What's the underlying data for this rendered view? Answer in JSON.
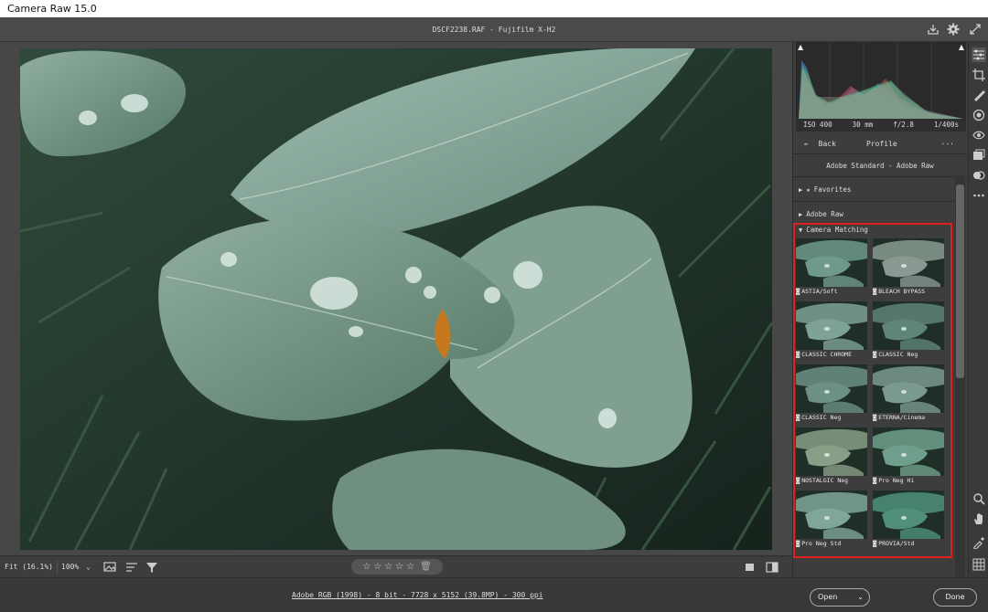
{
  "window": {
    "title": "Camera Raw 15.0"
  },
  "header": {
    "file_title": "DSCF2238.RAF  -  Fujifilm X-H2",
    "icons": [
      "save-icon",
      "gear-icon",
      "fullscreen-icon"
    ]
  },
  "histogram": {
    "shadow_clip": "▲",
    "highlight_clip": "▲",
    "exif": {
      "iso": "ISO 400",
      "focal": "30 mm",
      "aperture": "f/2.8",
      "shutter": "1/400s"
    }
  },
  "profile_browser": {
    "back_label": "Back",
    "title": "Profile",
    "more": "···",
    "selected_profile": "Adobe Standard - Adobe Raw",
    "groups": [
      {
        "label": "Favorites",
        "icon": "star-icon",
        "expanded": false
      },
      {
        "label": "Adobe Raw",
        "expanded": false
      },
      {
        "label": "Camera Matching",
        "expanded": true
      }
    ],
    "thumbnails": [
      {
        "label": "ASTIA/Soft"
      },
      {
        "label": "BLEACH BYPASS"
      },
      {
        "label": "CLASSIC CHROME"
      },
      {
        "label": "CLASSIC Neg"
      },
      {
        "label": "CLASSIC Neg"
      },
      {
        "label": "ETERNA/Cinema"
      },
      {
        "label": "NOSTALGIC Neg"
      },
      {
        "label": "Pro Neg Hi"
      },
      {
        "label": "Pro Neg Std"
      },
      {
        "label": "PROVIA/Std"
      }
    ],
    "highlight_color": "#e02020"
  },
  "bottom_toolbar": {
    "zoom_fit": "Fit (16.1%)",
    "zoom_level": "100%",
    "zoom_chevron": "⌄",
    "stars": [
      "☆",
      "☆",
      "☆",
      "☆",
      "☆"
    ],
    "trash": "🗑"
  },
  "status_bar": {
    "workflow": "Adobe RGB (1998) - 8 bit - 7728 x 5152 (39.8MP) - 300 ppi",
    "open_label": "Open",
    "open_chevron": "⌄",
    "done_label": "Done"
  },
  "right_toolbar": {
    "tools": [
      "edit-icon",
      "crop-icon",
      "heal-icon",
      "mask-icon",
      "redeye-icon",
      "snapshots-icon",
      "presets-icon",
      "more-icon",
      "zoom-icon",
      "hand-icon",
      "eyedropper-icon",
      "grid-icon"
    ]
  },
  "colors": {
    "background": "#3a3a3a",
    "panel": "#3d3d3d",
    "highlight": "#e02020"
  }
}
